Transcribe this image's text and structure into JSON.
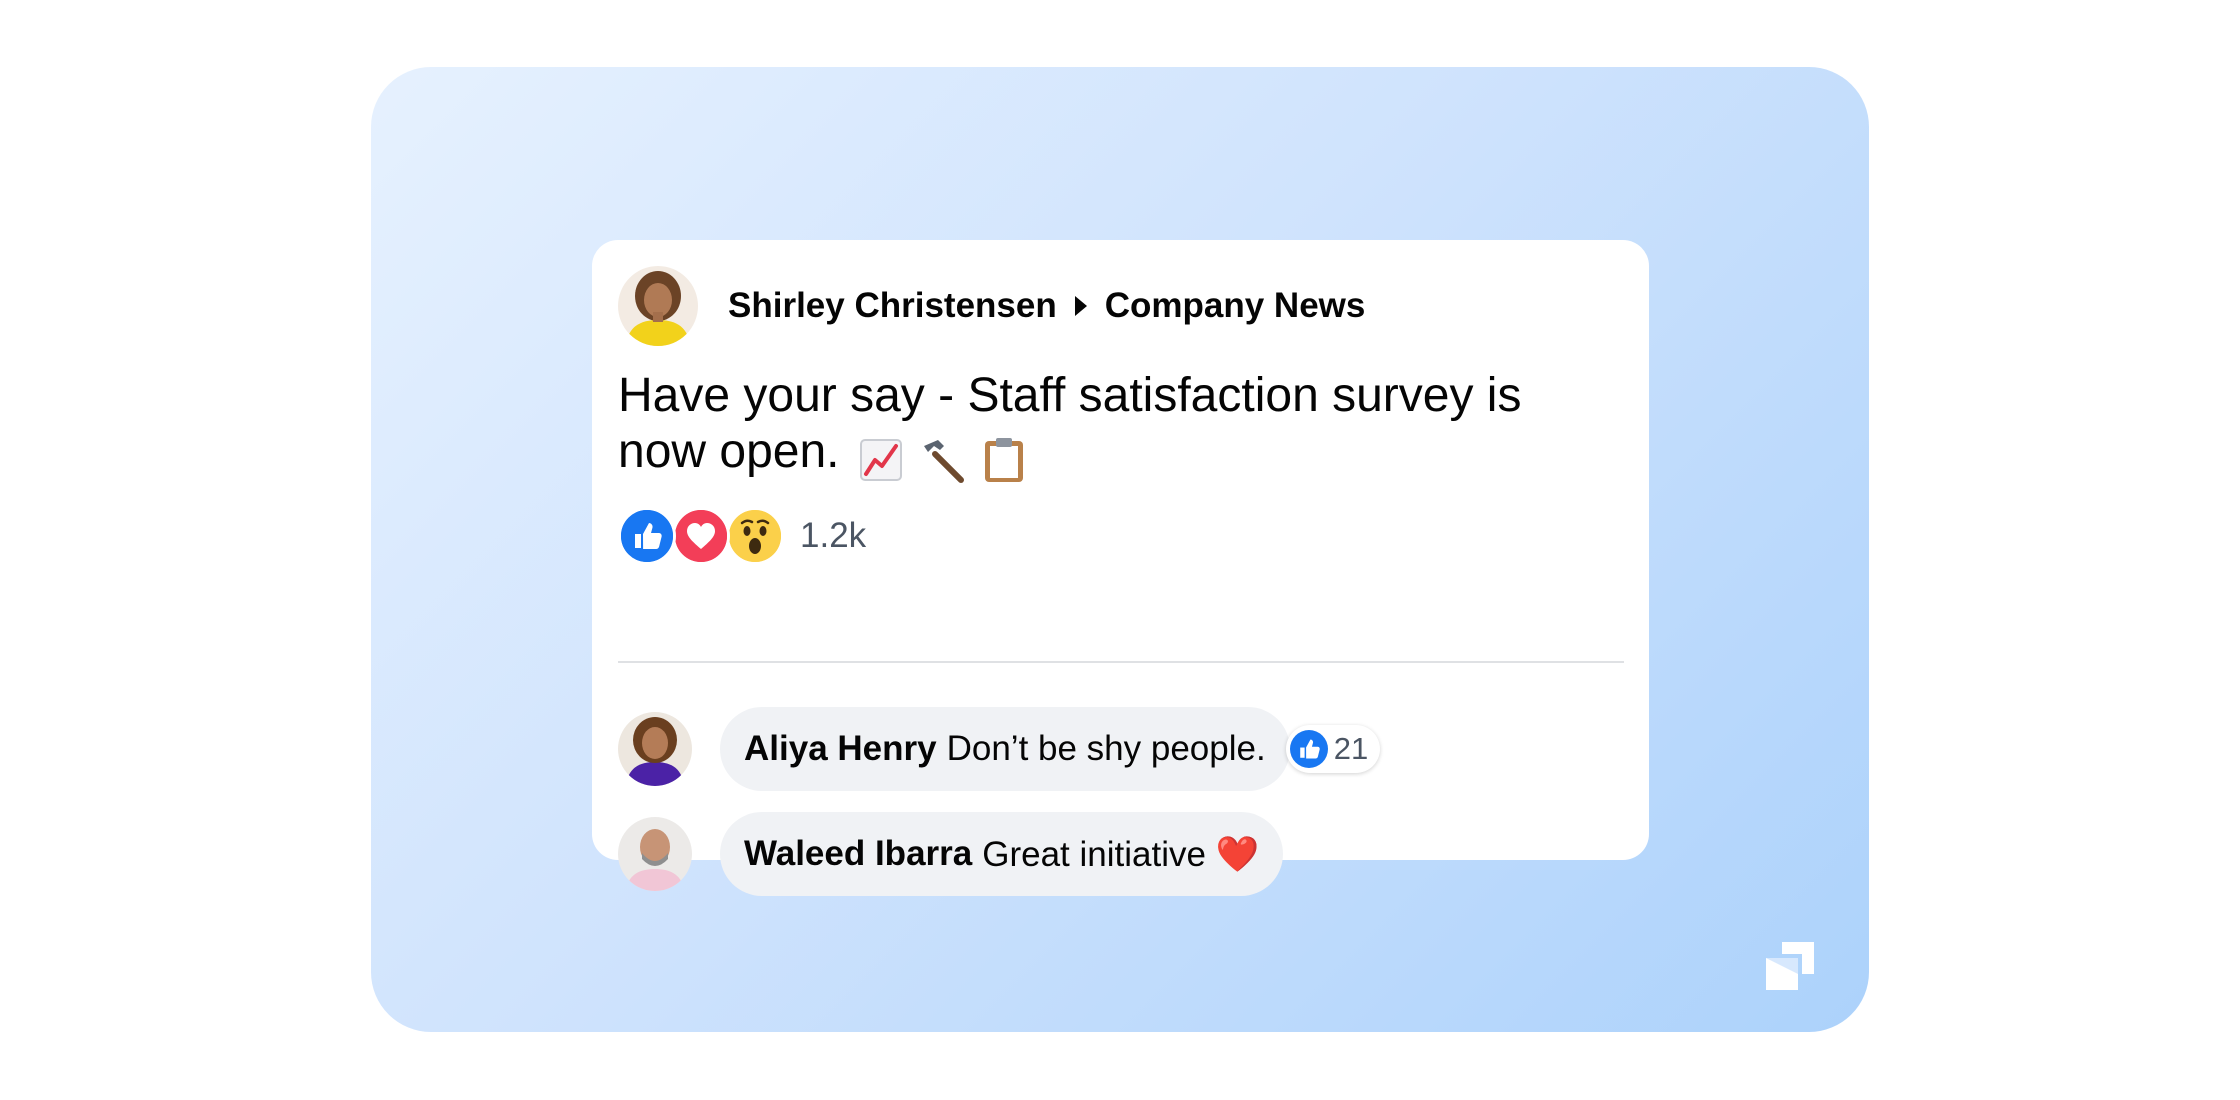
{
  "post": {
    "author": "Shirley Christensen",
    "group": "Company News",
    "text": "Have your say - Staff satisfaction survey is now open.",
    "emojis": [
      "chart-increasing-emoji",
      "hammer-emoji",
      "clipboard-emoji"
    ],
    "reactions": [
      "like-reaction-icon",
      "love-reaction-icon",
      "wow-reaction-icon"
    ],
    "reaction_count": "1.2k"
  },
  "comments": [
    {
      "author": "Aliya Henry",
      "text": "Don’t be shy people.",
      "likes": "21"
    },
    {
      "author": "Waleed Ibarra",
      "text": "Great initiative ❤️"
    }
  ],
  "colors": {
    "like_blue": "#1877f2",
    "love_red": "#f33e58",
    "wow_yellow": "#fbd04a",
    "bubble_bg": "#f0f2f5",
    "panel_gradient": [
      "#e6f1fe",
      "#acd2fb"
    ]
  }
}
